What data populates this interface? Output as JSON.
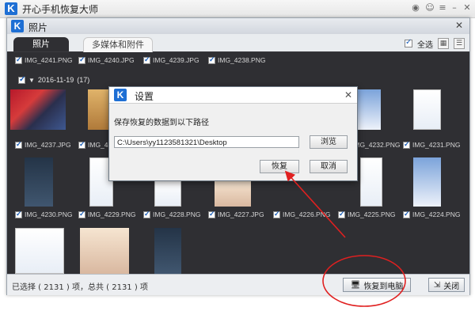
{
  "app": {
    "title": "开心手机恢复大师",
    "logo": "K"
  },
  "window": {
    "title": "照片",
    "tabs": [
      {
        "label": "照片"
      },
      {
        "label": "多媒体和附件"
      }
    ],
    "select_all_label": "全选",
    "view_icons": [
      "grid-view-icon",
      "list-view-icon"
    ]
  },
  "rows": [
    {
      "items": [
        "IMG_4241.PNG",
        "IMG_4240.JPG",
        "IMG_4239.JPG",
        "IMG_4238.PNG"
      ]
    },
    {
      "items": [
        "IMG_4237.JPG",
        "IMG_423",
        "IMG_4232.PNG",
        "IMG_4231.PNG"
      ]
    },
    {
      "items": [
        "IMG_4230.PNG",
        "IMG_4229.PNG",
        "IMG_4228.PNG",
        "IMG_4227.JPG",
        "IMG_4226.PNG",
        "IMG_4225.PNG",
        "IMG_4224.PNG"
      ]
    }
  ],
  "group": {
    "date": "2016-11-19",
    "count": "(17)"
  },
  "status": {
    "text": "已选择 ( 2131 ) 项，总共 ( 2131 ) 项"
  },
  "buttons": {
    "restore": "恢复到电脑",
    "close": "关闭"
  },
  "dialog": {
    "title": "设置",
    "label": "保存恢复的数据到以下路径",
    "path": "C:\\Users\\yy1123581321\\Desktop",
    "browse": "浏览",
    "ok": "恢复",
    "cancel": "取消"
  },
  "colors": {
    "brand": "#1e6fd4",
    "annotation": "#e02020",
    "window_bg": "#2f2f33"
  }
}
